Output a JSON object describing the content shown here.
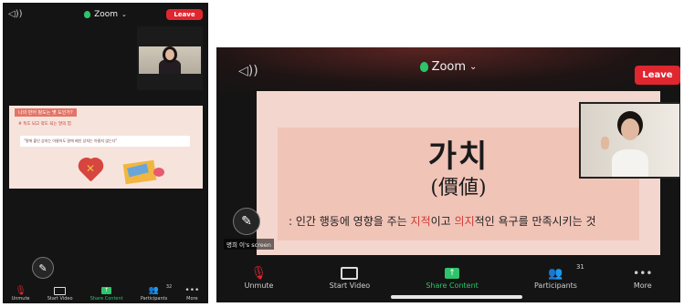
{
  "left_phone": {
    "app_title": "Zoom",
    "leave_label": "Leave",
    "slide": {
      "tag": "나의 만어 팡도는 몇 도인가?",
      "subtitle": "# 독도 되고 약도 되는 말의 힘",
      "quote": "\"말에 붙인 상처는 아물어도 말에 베인 상처는 아물지 않는다\""
    },
    "toolbar": {
      "unmute": "Unmute",
      "start_video": "Start Video",
      "share_content": "Share Content",
      "participants": "Participants",
      "participants_count": "32",
      "more": "More"
    }
  },
  "right_phone": {
    "app_title": "Zoom",
    "leave_label": "Leave",
    "slide": {
      "title": "가치",
      "hanja": "(價値)",
      "definition_prefix": ": 인간 행동에 영향을 주는 ",
      "highlight_1": "지적",
      "mid_1": "이고 ",
      "highlight_2": "의지",
      "definition_suffix": "적인 욕구를 만족시키는 것"
    },
    "screen_label": "명희 이's screen",
    "toolbar": {
      "unmute": "Unmute",
      "start_video": "Start Video",
      "share_content": "Share Content",
      "participants": "Participants",
      "participants_count": "31",
      "more": "More"
    }
  },
  "colors": {
    "leave": "#e0262f",
    "shield": "#2ec46b",
    "share_green": "#2ec46b",
    "highlight_red": "#d13a31"
  },
  "icons": [
    "speaker-icon",
    "shield-icon",
    "chevron-down-icon",
    "pen-icon",
    "mic-off-icon",
    "video-off-icon",
    "share-icon",
    "participants-icon",
    "more-icon"
  ]
}
